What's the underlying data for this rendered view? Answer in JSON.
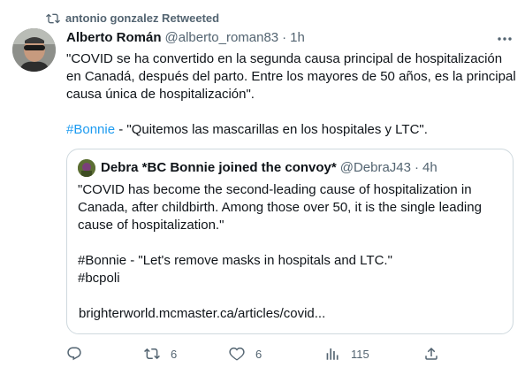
{
  "retweet": {
    "text": "antonio gonzalez Retweeted"
  },
  "tweet": {
    "author_name": "Alberto Román",
    "author_handle": "@alberto_roman83",
    "separator": "·",
    "time": "1h",
    "body_paragraph_1": "\"COVID se ha convertido en la segunda causa principal de hospitalización\nen Canadá, después del parto. Entre los mayores de 50 años, es la principal\ncausa única de hospitalización\".",
    "hashtag": "#Bonnie",
    "body_paragraph_2_rest": " - \"Quitemos las mascarillas en los hospitales y LTC\"."
  },
  "quote": {
    "author_name": "Debra *BC Bonnie joined the convoy*",
    "author_handle": "@DebraJ43",
    "separator": "·",
    "time": "4h",
    "body_paragraph_1": "\"COVID has become the second-leading cause of hospitalization in\nCanada, after childbirth. Among those over 50, it is the single leading\ncause of hospitalization.\"",
    "body_paragraph_2": "#Bonnie - \"Let's remove masks in hospitals and LTC.\"\n#bcpoli",
    "link": "brighterworld.mcmaster.ca/articles/covid..."
  },
  "actions": {
    "reply_count": "",
    "retweet_count": "6",
    "like_count": "6",
    "views_count": "115"
  },
  "colors": {
    "accent": "#1d9bf0",
    "text_primary": "#0f1419",
    "text_secondary": "#536471",
    "border": "#cfd9de"
  },
  "icons": [
    "retweet-icon",
    "more-icon",
    "reply-icon",
    "retweet-icon",
    "like-icon",
    "views-icon",
    "share-icon"
  ]
}
